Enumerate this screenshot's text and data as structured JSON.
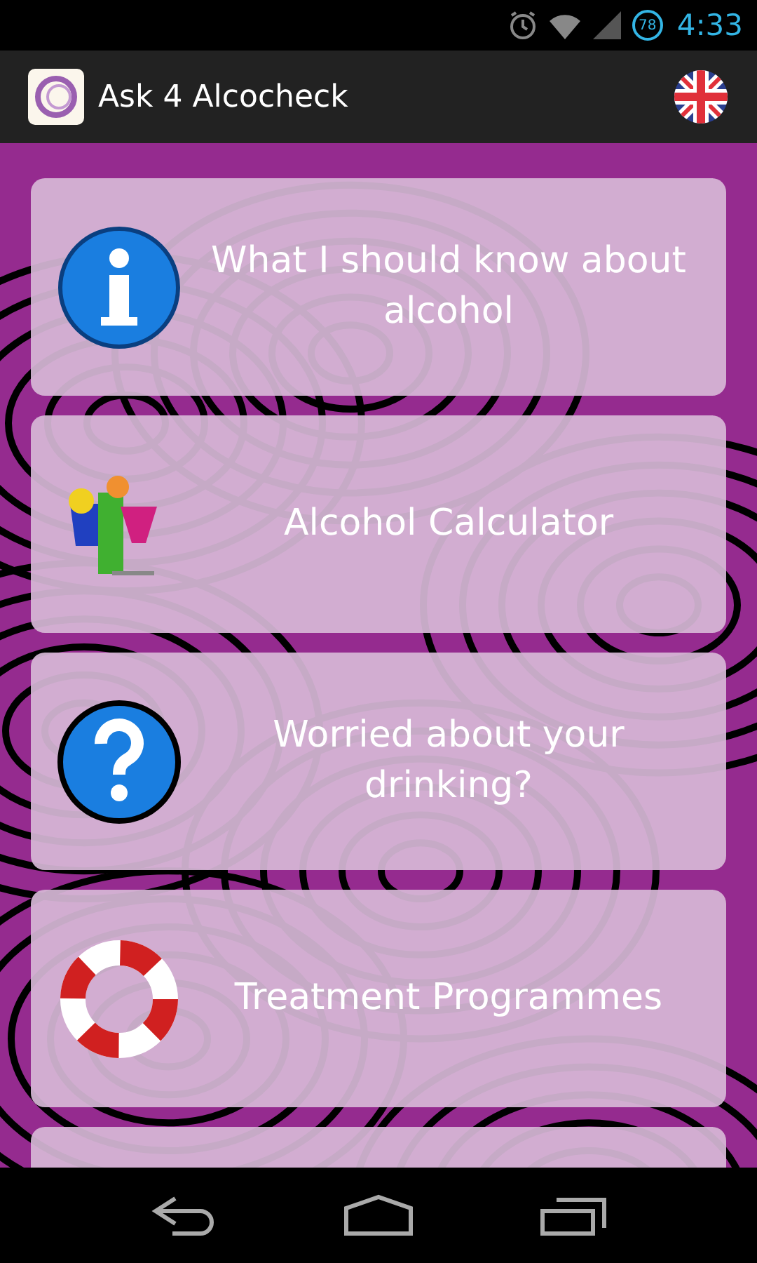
{
  "status_bar": {
    "battery": "78",
    "time": "4:33"
  },
  "app_bar": {
    "title": "Ask 4 Alcocheck"
  },
  "menu": [
    {
      "kind": "info",
      "label": "What I should know about alcohol"
    },
    {
      "kind": "cocktail",
      "label": "Alcohol Calculator"
    },
    {
      "kind": "question",
      "label": "Worried about your drinking?"
    },
    {
      "kind": "lifebuoy",
      "label": "Treatment Programmes"
    }
  ]
}
